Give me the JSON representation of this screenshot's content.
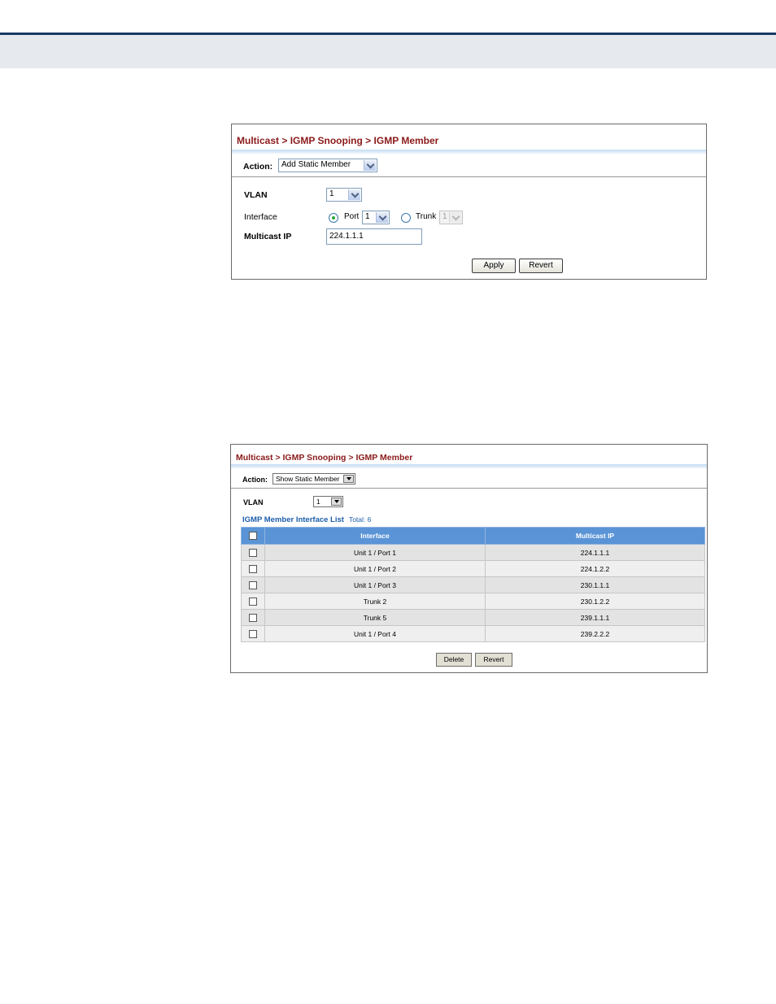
{
  "panel_add": {
    "breadcrumb": [
      "Multicast",
      "IGMP Snooping",
      "IGMP Member"
    ],
    "separator": ">",
    "action_label": "Action:",
    "action_value": "Add Static Member",
    "vlan_label": "VLAN",
    "vlan_value": "1",
    "interface_label": "Interface",
    "port_label": "Port",
    "port_value": "1",
    "port_selected": true,
    "trunk_label": "Trunk",
    "trunk_value": "1",
    "multicast_ip_label": "Multicast IP",
    "multicast_ip_value": "224.1.1.1",
    "apply_label": "Apply",
    "revert_label": "Revert"
  },
  "panel_show": {
    "breadcrumb": [
      "Multicast",
      "IGMP Snooping",
      "IGMP Member"
    ],
    "separator": ">",
    "action_label": "Action:",
    "action_value": "Show Static Member",
    "vlan_label": "VLAN",
    "vlan_value": "1",
    "list_title": "IGMP Member Interface List",
    "total_text": "Total: 6",
    "columns": [
      "Interface",
      "Multicast IP"
    ],
    "rows": [
      {
        "interface": "Unit 1 / Port 1",
        "ip": "224.1.1.1"
      },
      {
        "interface": "Unit 1 / Port 2",
        "ip": "224.1.2.2"
      },
      {
        "interface": "Unit 1 / Port 3",
        "ip": "230.1.1.1"
      },
      {
        "interface": "Trunk 2",
        "ip": "230.1.2.2"
      },
      {
        "interface": "Trunk 5",
        "ip": "239.1.1.1"
      },
      {
        "interface": "Unit 1 / Port 4",
        "ip": "239.2.2.2"
      }
    ],
    "delete_label": "Delete",
    "revert_label": "Revert"
  },
  "colors": {
    "breadcrumb": "#8b1a1a",
    "table_header": "#5a94d6",
    "list_title": "#1b5eab",
    "top_rule": "#1a3a66"
  }
}
